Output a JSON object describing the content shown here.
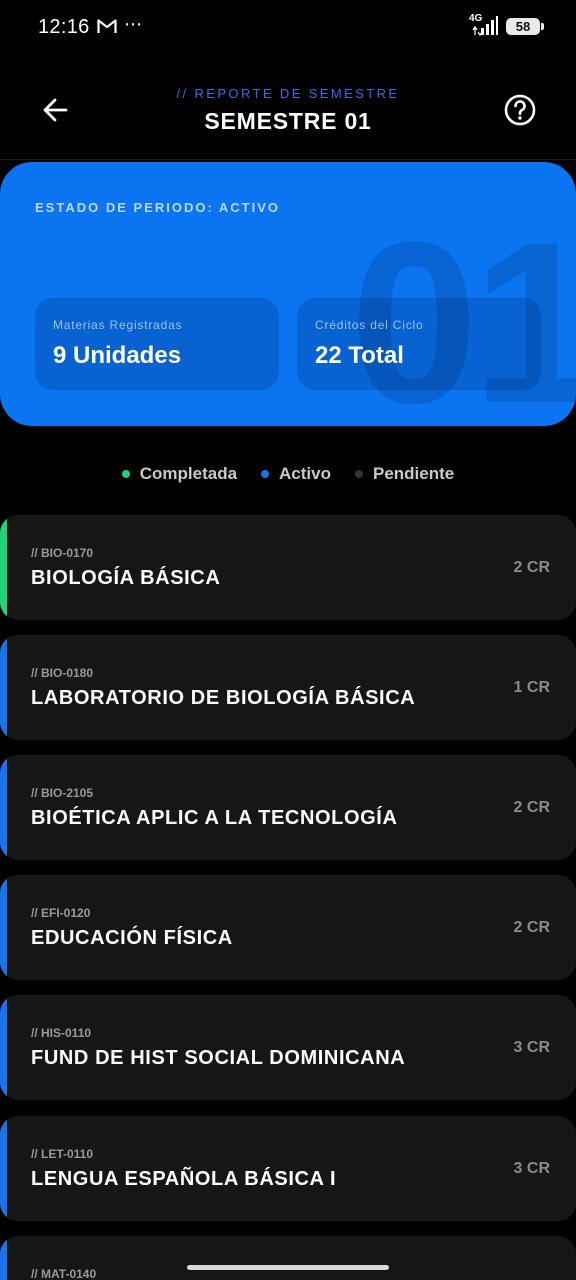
{
  "status_bar": {
    "time": "12:16",
    "more": "⋯",
    "network": "4G",
    "battery": "58"
  },
  "header": {
    "kicker": "// REPORTE DE SEMESTRE",
    "title": "SEMESTRE 01"
  },
  "summary": {
    "period_status": "ESTADO DE PERIODO: ACTIVO",
    "watermark": "01",
    "subjects_label": "Materias Registradas",
    "subjects_value": "9 Unidades",
    "credits_label": "Créditos del Ciclo",
    "credits_value": "22 Total",
    "card_color": "#0b74f0"
  },
  "legend": [
    {
      "label": "Completada",
      "color": "#22d17a"
    },
    {
      "label": "Activo",
      "color": "#1a73e8"
    },
    {
      "label": "Pendiente",
      "color": "#333333"
    }
  ],
  "courses": [
    {
      "code": "// BIO-0170",
      "name": "BIOLOGÍA BÁSICA",
      "credits": "2 CR",
      "status_color": "#22d17a"
    },
    {
      "code": "// BIO-0180",
      "name": "LABORATORIO DE BIOLOGÍA BÁSICA",
      "credits": "1 CR",
      "status_color": "#1a73e8"
    },
    {
      "code": "// BIO-2105",
      "name": "BIOÉTICA APLIC A LA TECNOLOGÍA",
      "credits": "2 CR",
      "status_color": "#1a73e8"
    },
    {
      "code": "// EFI-0120",
      "name": "EDUCACIÓN FÍSICA",
      "credits": "2 CR",
      "status_color": "#1a73e8"
    },
    {
      "code": "// HIS-0110",
      "name": "FUND DE HIST SOCIAL DOMINICANA",
      "credits": "3 CR",
      "status_color": "#1a73e8"
    },
    {
      "code": "// LET-0110",
      "name": "LENGUA ESPAÑOLA BÁSICA I",
      "credits": "3 CR",
      "status_color": "#1a73e8"
    },
    {
      "code": "// MAT-0140",
      "name": "",
      "credits": "",
      "status_color": "#1a73e8"
    }
  ]
}
